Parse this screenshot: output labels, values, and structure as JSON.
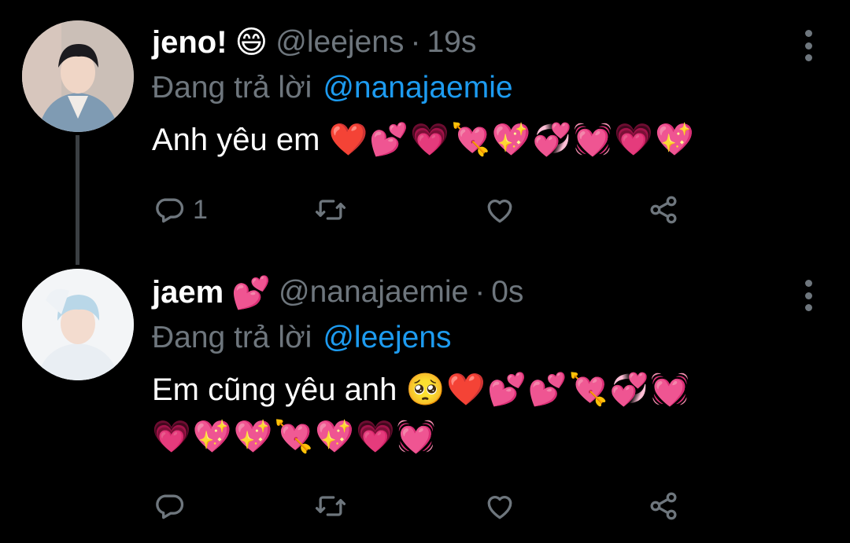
{
  "tweets": [
    {
      "name": "jeno!",
      "name_emoji": "😄",
      "handle": "@leejens",
      "separator": "·",
      "time": "19s",
      "replying_to_label": "Đang trả lời",
      "replying_to": "@nanajaemie",
      "text": "Anh yêu em",
      "text_emojis": "❤️💕💗💘💖💞💓💗💖",
      "reply_count": "1",
      "icons": [
        "more-vertical-icon",
        "reply-icon",
        "retweet-icon",
        "like-icon",
        "share-icon"
      ]
    },
    {
      "name": "jaem",
      "name_emoji": "💕",
      "handle": "@nanajaemie",
      "separator": "·",
      "time": "0s",
      "replying_to_label": "Đang trả lời",
      "replying_to": "@leejens",
      "text": "Em cũng yêu anh",
      "text_emojis_line1": "🥺❤️💕💕💘💞💓",
      "text_emojis_line2": "💗💖💖💘💖💗💓",
      "reply_count": "",
      "icons": [
        "more-vertical-icon",
        "reply-icon",
        "retweet-icon",
        "like-icon",
        "share-icon"
      ]
    }
  ],
  "colors": {
    "background": "#000000",
    "text": "#ffffff",
    "secondary": "#6e767d",
    "mention": "#1d9bf0",
    "thread_line": "#3b3f43"
  }
}
